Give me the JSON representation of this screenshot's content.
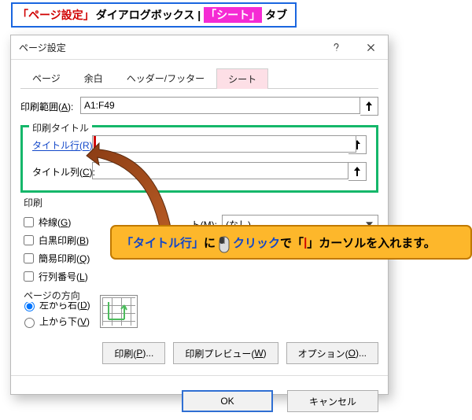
{
  "caption": {
    "red1": "「ページ設定」",
    "mid": "ダイアログボックス | ",
    "pink": "「シート」",
    "tail": "タブ"
  },
  "dialog": {
    "title": "ページ設定",
    "tabs": {
      "page": "ページ",
      "margin": "余白",
      "header": "ヘッダー/フッター",
      "sheet": "シート"
    },
    "print_area": {
      "label": "印刷範囲(",
      "shortcut": "A",
      "colon": "):",
      "value": "A1:F49"
    },
    "title_group": {
      "caption": "印刷タイトル",
      "row": {
        "label": "タイトル行(",
        "shortcut": "R",
        "colon": "):",
        "value": ""
      },
      "col": {
        "label": "タイトル列(",
        "shortcut": "C",
        "colon": "):",
        "value": ""
      }
    },
    "print_group": {
      "caption": "印刷",
      "gridlines": {
        "label": "枠線(",
        "shortcut": "G",
        "tail": ")"
      },
      "bw": {
        "label": "白黒印刷(",
        "shortcut": "B",
        "tail": ")"
      },
      "draft": {
        "label": "簡易印刷(",
        "shortcut": "Q",
        "tail": ")"
      },
      "rowcolnum": {
        "label": "行列番号(",
        "shortcut": "L",
        "tail": ")"
      },
      "comments": {
        "label_head": "ト(",
        "shortcut": "M",
        "tail": "):",
        "value": "(なし)"
      },
      "errors": {
        "label_head": "",
        "shortcut": "",
        "tail": "",
        "value": ""
      }
    },
    "order_group": {
      "caption": "ページの方向",
      "l2r": {
        "label": "左から右(",
        "shortcut": "D",
        "tail": ")"
      },
      "t2b": {
        "label": "上から下(",
        "shortcut": "V",
        "tail": ")"
      }
    },
    "buttons": {
      "print": {
        "label": "印刷(",
        "shortcut": "P",
        "tail": ")..."
      },
      "preview": {
        "label": "印刷プレビュー(",
        "shortcut": "W",
        "tail": ")"
      },
      "options": {
        "label": "オプション(",
        "shortcut": "O",
        "tail": ")..."
      },
      "ok": "OK",
      "cancel": "キャンセル"
    }
  },
  "balloon": {
    "a": "「タイトル行」",
    "b": "に ",
    "c": "クリック",
    "d": "で「",
    "e": "|",
    "f": "」カーソルを入れます。"
  }
}
